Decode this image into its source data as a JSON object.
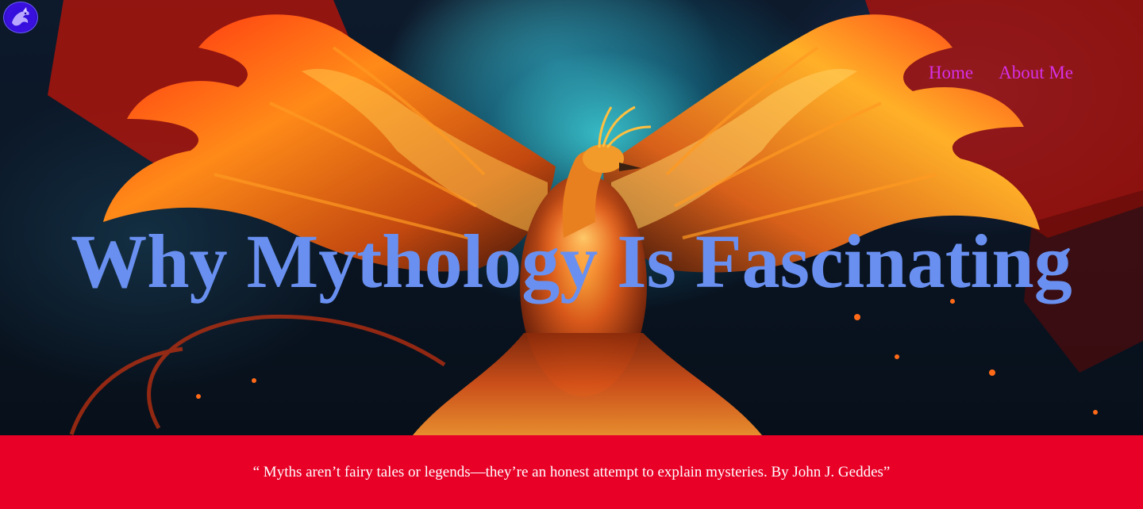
{
  "nav": {
    "items": [
      {
        "label": "Home"
      },
      {
        "label": "About Me"
      }
    ],
    "link_color": "#d630e6"
  },
  "logo": {
    "icon": "purple-dragon-logo-icon",
    "color": "#3b10e0"
  },
  "hero": {
    "title": "Why Mythology Is Fascinating",
    "title_color": "#6990f0",
    "background_image": "phoenix-artwork"
  },
  "quote": {
    "text": "“ Myths aren’t fairy tales or legends—they’re an honest attempt to explain mysteries. By John J. Geddes”",
    "band_color": "#e80027",
    "text_color": "#ffffff"
  }
}
